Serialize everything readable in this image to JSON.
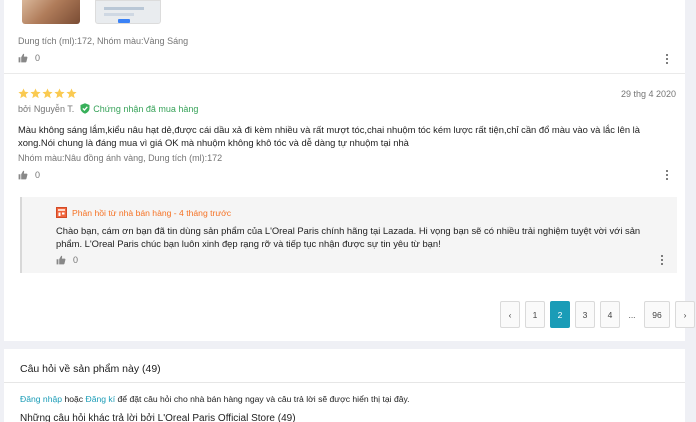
{
  "previous_review": {
    "variant": "Dung tích (ml):172, Nhóm màu:Vàng Sáng",
    "likes": "0"
  },
  "review": {
    "rating": 5,
    "date": "29 thg 4 2020",
    "by_prefix": "bởi",
    "author": "Nguyễn T.",
    "verified": "Chứng nhận đã mua hàng",
    "body": "Màu không sáng lắm,kiểu nâu hạt dẻ,được cái dầu xả đi kèm nhiều và rất mượt tóc,chai nhuộm tóc kém lược rất tiện,chỉ cần đổ màu vào và lắc lên là xong.Nói chung là đáng mua vì giá OK mà nhuộm không khô tóc và dễ dàng tự nhuộm tại nhà",
    "variant": "Nhóm màu:Nâu đồng ánh vàng, Dung tích (ml):172",
    "likes": "0",
    "star_color": "#faca51"
  },
  "seller_reply": {
    "header": "Phản hồi từ nhà bán hàng - 4 tháng trước",
    "body": "Chào bạn, cám ơn bạn đã tin dùng sản phẩm của L'Oreal Paris chính hãng tại Lazada. Hi vọng bạn sẽ có nhiều trải nghiệm tuyệt vời với sản phẩm. L'Oreal Paris chúc bạn luôn xinh đẹp rạng rỡ và tiếp tục nhận được sự tin yêu từ bạn!",
    "likes": "0",
    "header_color": "#f57224"
  },
  "pagination": {
    "prev": "‹",
    "pages": [
      "1",
      "2",
      "3",
      "4"
    ],
    "active": "2",
    "ellipsis": "...",
    "last": "96",
    "next": "›",
    "accent": "#1a9cb7"
  },
  "questions": {
    "title": "Câu hỏi về sản phẩm này (49)",
    "login": "Đăng nhập",
    "or": "hoặc",
    "register": "Đăng kí",
    "prompt_rest": "để đặt câu hỏi cho nhà bán hàng ngay và câu trả lời sẽ được hiển thị tại đây.",
    "others": "Những câu hỏi khác trả lời bởi L'Oreal Paris  Official Store (49)"
  }
}
